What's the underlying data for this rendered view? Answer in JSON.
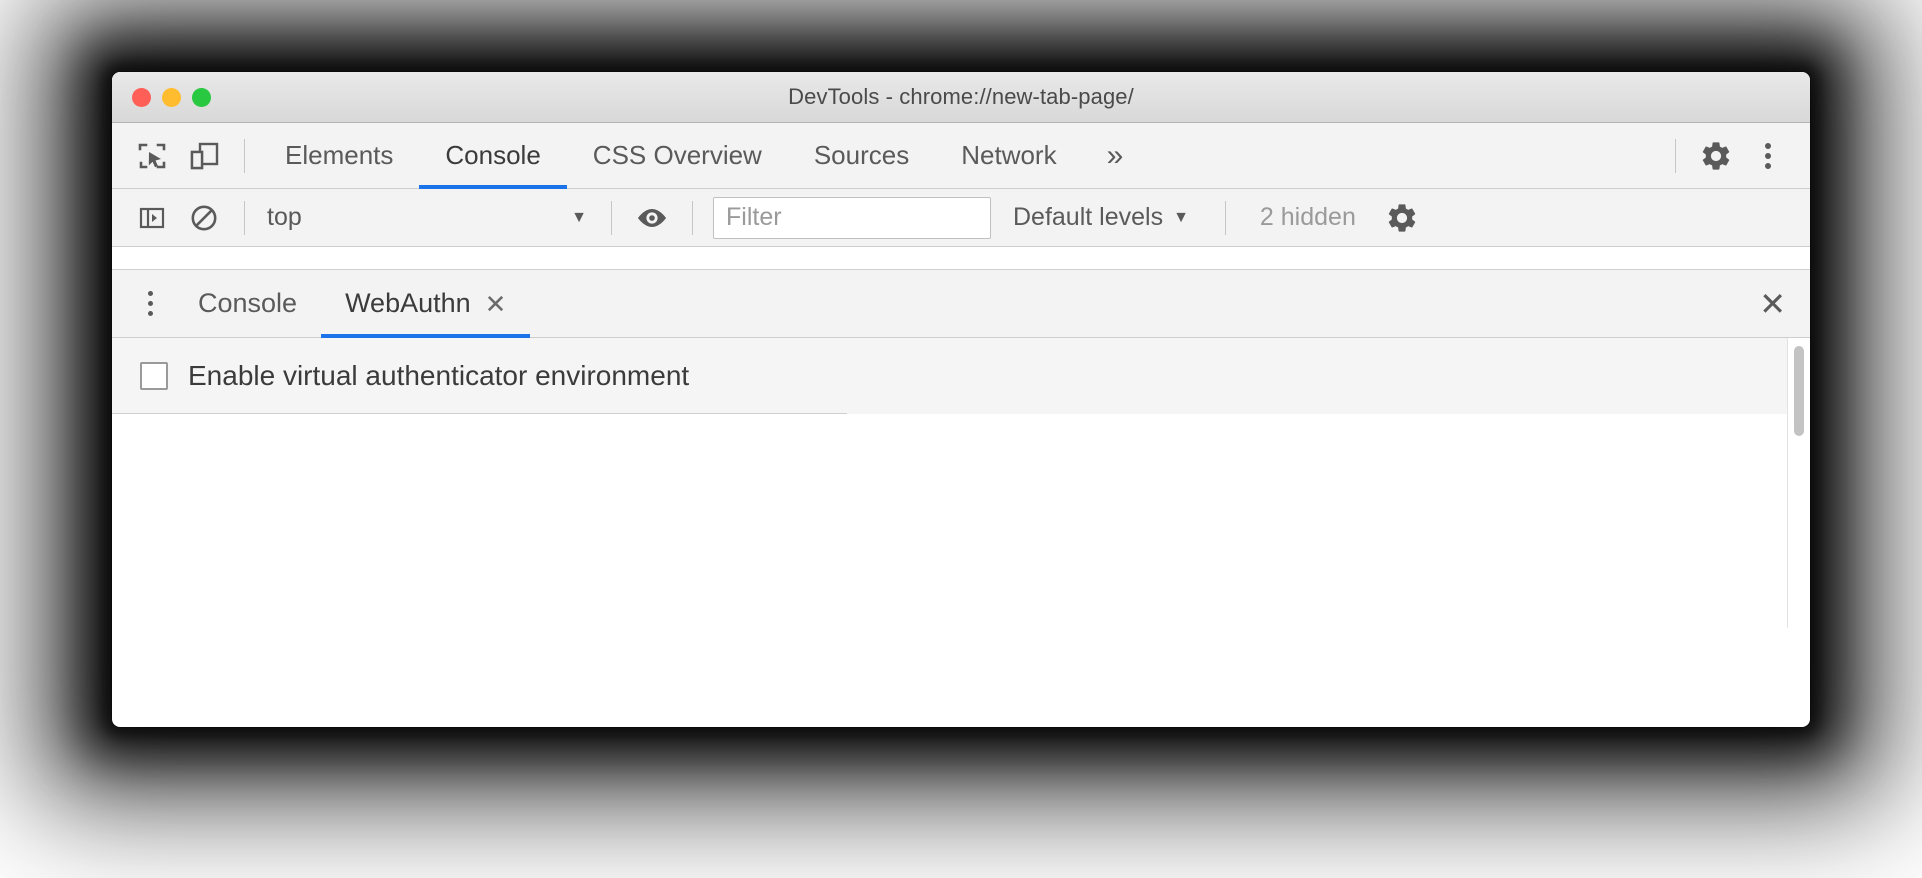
{
  "window": {
    "title": "DevTools - chrome://new-tab-page/",
    "traffic_lights": {
      "close": "close-window",
      "minimize": "minimize-window",
      "maximize": "maximize-window"
    },
    "colors": {
      "accent": "#1a73e8",
      "close_dot": "#ff5f57",
      "minimize_dot": "#febc2e",
      "maximize_dot": "#28c840",
      "toolbar_bg": "#f3f3f3",
      "text": "#5a5a5a"
    }
  },
  "main_toolbar": {
    "inspect_icon": "inspect-element-icon",
    "device_toolbar_icon": "device-toolbar-icon",
    "tabs": [
      {
        "label": "Elements",
        "active": false
      },
      {
        "label": "Console",
        "active": true
      },
      {
        "label": "CSS Overview",
        "active": false
      },
      {
        "label": "Sources",
        "active": false
      },
      {
        "label": "Network",
        "active": false
      }
    ],
    "more_tabs_label": "»",
    "settings_icon": "gear-icon",
    "more_options_icon": "kebab-menu-icon"
  },
  "console_toolbar": {
    "sidebar_toggle_icon": "console-sidebar-icon",
    "clear_console_icon": "clear-console-icon",
    "context": {
      "value": "top",
      "caret": "▼"
    },
    "live_expression_icon": "eye-icon",
    "filter": {
      "placeholder": "Filter",
      "value": ""
    },
    "levels": {
      "label": "Default levels",
      "caret": "▼"
    },
    "hidden_messages": "2 hidden",
    "settings_icon": "gear-icon"
  },
  "drawer": {
    "more_tools_icon": "kebab-menu-icon",
    "tabs": [
      {
        "label": "Console",
        "active": false,
        "closable": false
      },
      {
        "label": "WebAuthn",
        "active": true,
        "closable": true,
        "close_glyph": "✕"
      }
    ],
    "close_drawer_glyph": "✕"
  },
  "webauthn_panel": {
    "enable_checkbox": {
      "label": "Enable virtual authenticator environment",
      "checked": false
    }
  }
}
